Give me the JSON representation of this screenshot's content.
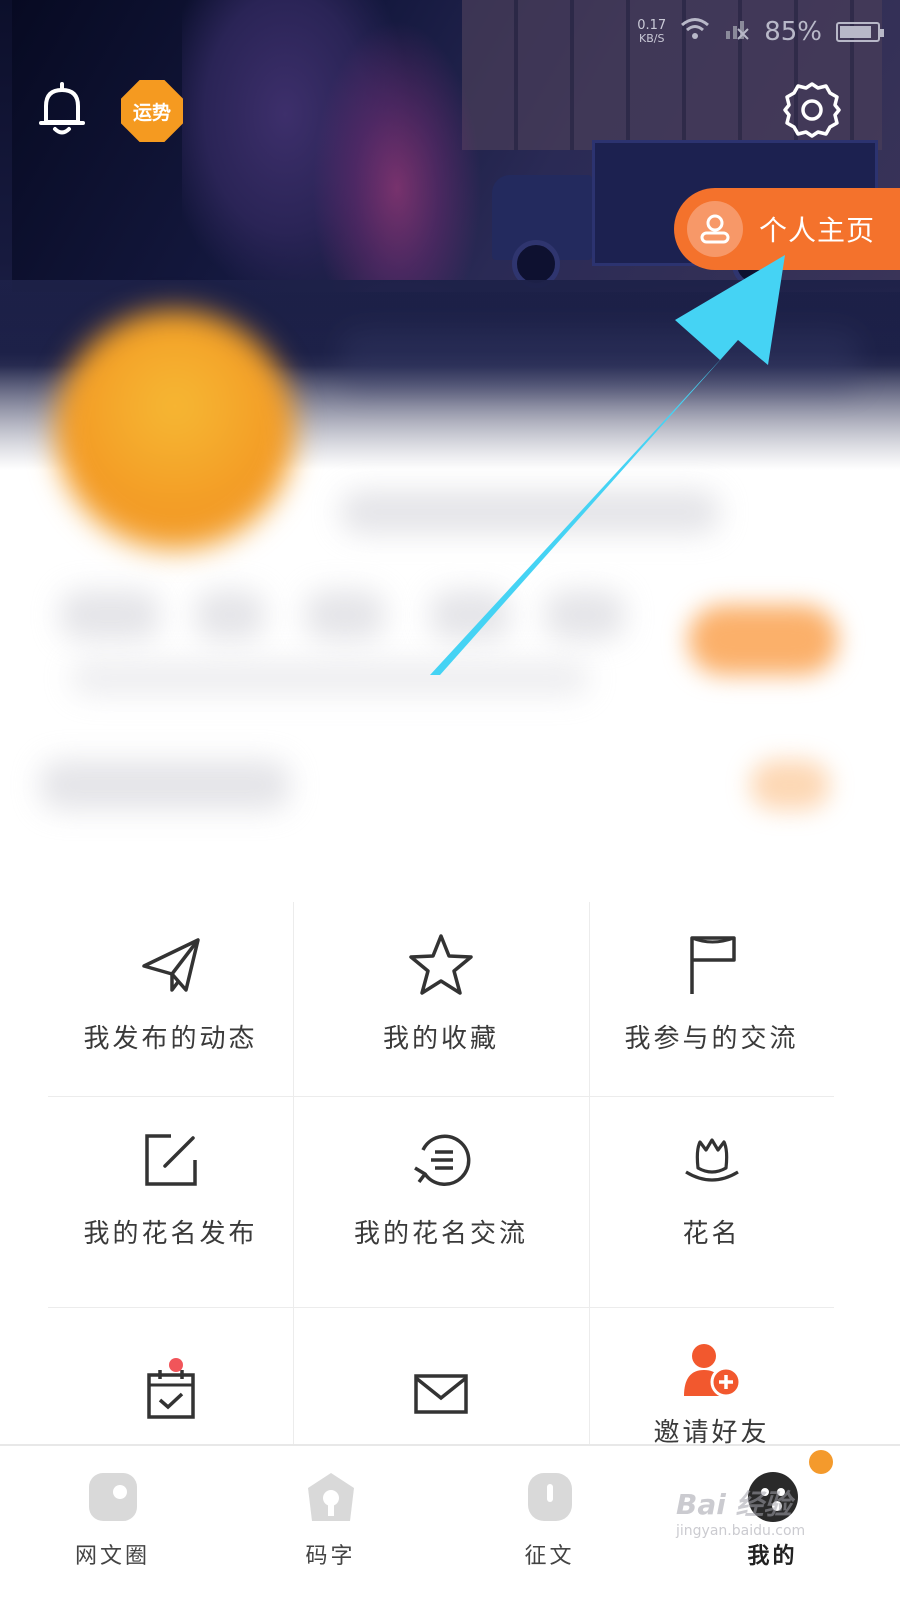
{
  "status_bar": {
    "speed_value": "0.17",
    "speed_unit": "KB/S",
    "battery_percent": "85%",
    "battery_level": 0.85
  },
  "header": {
    "fortune_badge": "运势",
    "profile_button": "个人主页",
    "icons": [
      "bell-icon",
      "settings-gear-icon",
      "user-icon"
    ]
  },
  "grid": {
    "items": [
      {
        "label": "我发布的动态",
        "icon": "paper-plane-icon"
      },
      {
        "label": "我的收藏",
        "icon": "star-icon"
      },
      {
        "label": "我参与的交流",
        "icon": "flag-icon"
      },
      {
        "label": "我的花名发布",
        "icon": "edit-square-icon"
      },
      {
        "label": "我的花名交流",
        "icon": "chat-refresh-icon"
      },
      {
        "label": "花名",
        "icon": "lotus-icon"
      },
      {
        "label": "",
        "icon": "calendar-check-icon",
        "badge_dot": true
      },
      {
        "label": "",
        "icon": "mail-icon"
      },
      {
        "label": "邀请好友",
        "icon": "invite-friend-icon"
      }
    ]
  },
  "tabbar": {
    "tabs": [
      {
        "label": "网文圈",
        "icon": "circle-tab-icon"
      },
      {
        "label": "码字",
        "icon": "house-tab-icon"
      },
      {
        "label": "征文",
        "icon": "essay-tab-icon"
      },
      {
        "label": "我的",
        "icon": "me-tab-icon",
        "active": true
      }
    ]
  },
  "watermark": {
    "line1": "Bai 经验",
    "line2": "jingyan.baidu.com"
  },
  "colors": {
    "accent_orange": "#f4722c",
    "badge_orange": "#f59a20",
    "annotation_arrow": "#45d3f4",
    "dark_header": "#0c0f2b"
  }
}
